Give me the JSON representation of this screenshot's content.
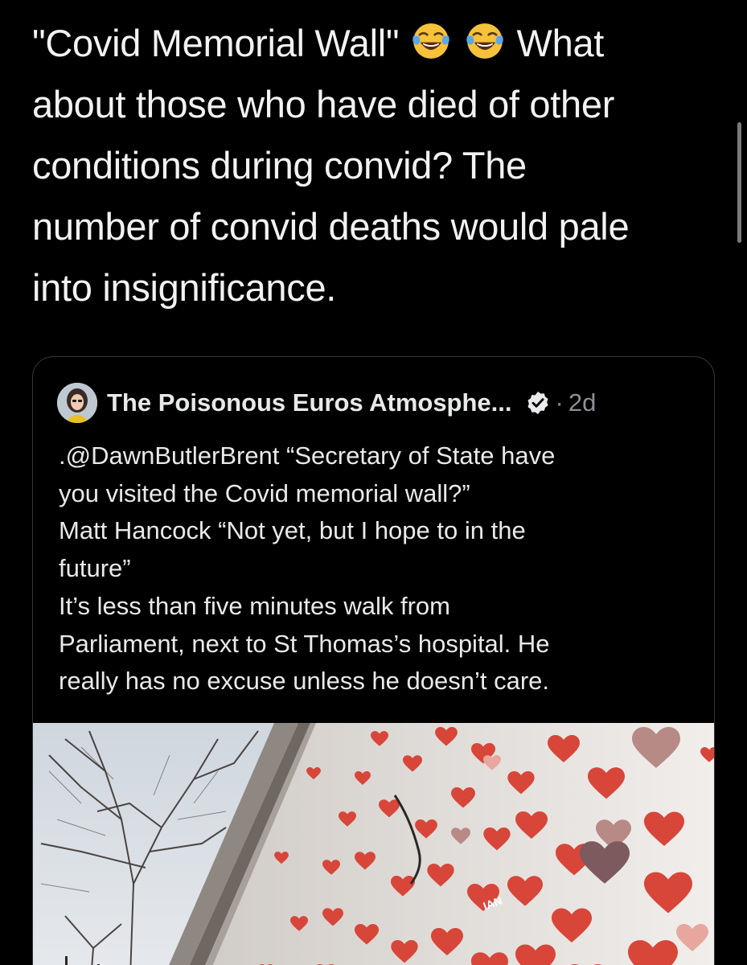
{
  "tweet": {
    "lines": [
      "\"Covid Memorial Wall\"",
      "What",
      "about those who have died of other",
      "conditions during convid?   The",
      "number of convid deaths would pale",
      "into insignificance."
    ],
    "emoji": [
      "tears-of-joy-emoji",
      "tears-of-joy-emoji"
    ]
  },
  "quoted_tweet": {
    "author_name": "The Poisonous Euros Atmosphe...",
    "verified": true,
    "separator": "·",
    "time": "2d",
    "text_lines": [
      ".@DawnButlerBrent “Secretary of State have",
      "you visited the Covid memorial wall?”",
      "Matt Hancock “Not yet, but I hope to in the",
      "future”",
      "It’s less than five minutes walk from",
      "Parliament, next to St Thomas’s hospital. He",
      "really has no excuse unless he doesn’t care."
    ],
    "media_heart_text": "IAN"
  },
  "colors": {
    "background": "#000000",
    "text": "#e7e9ea",
    "secondary": "#8b9096",
    "card_border": "#333639",
    "heart_red": "#d8463a"
  }
}
